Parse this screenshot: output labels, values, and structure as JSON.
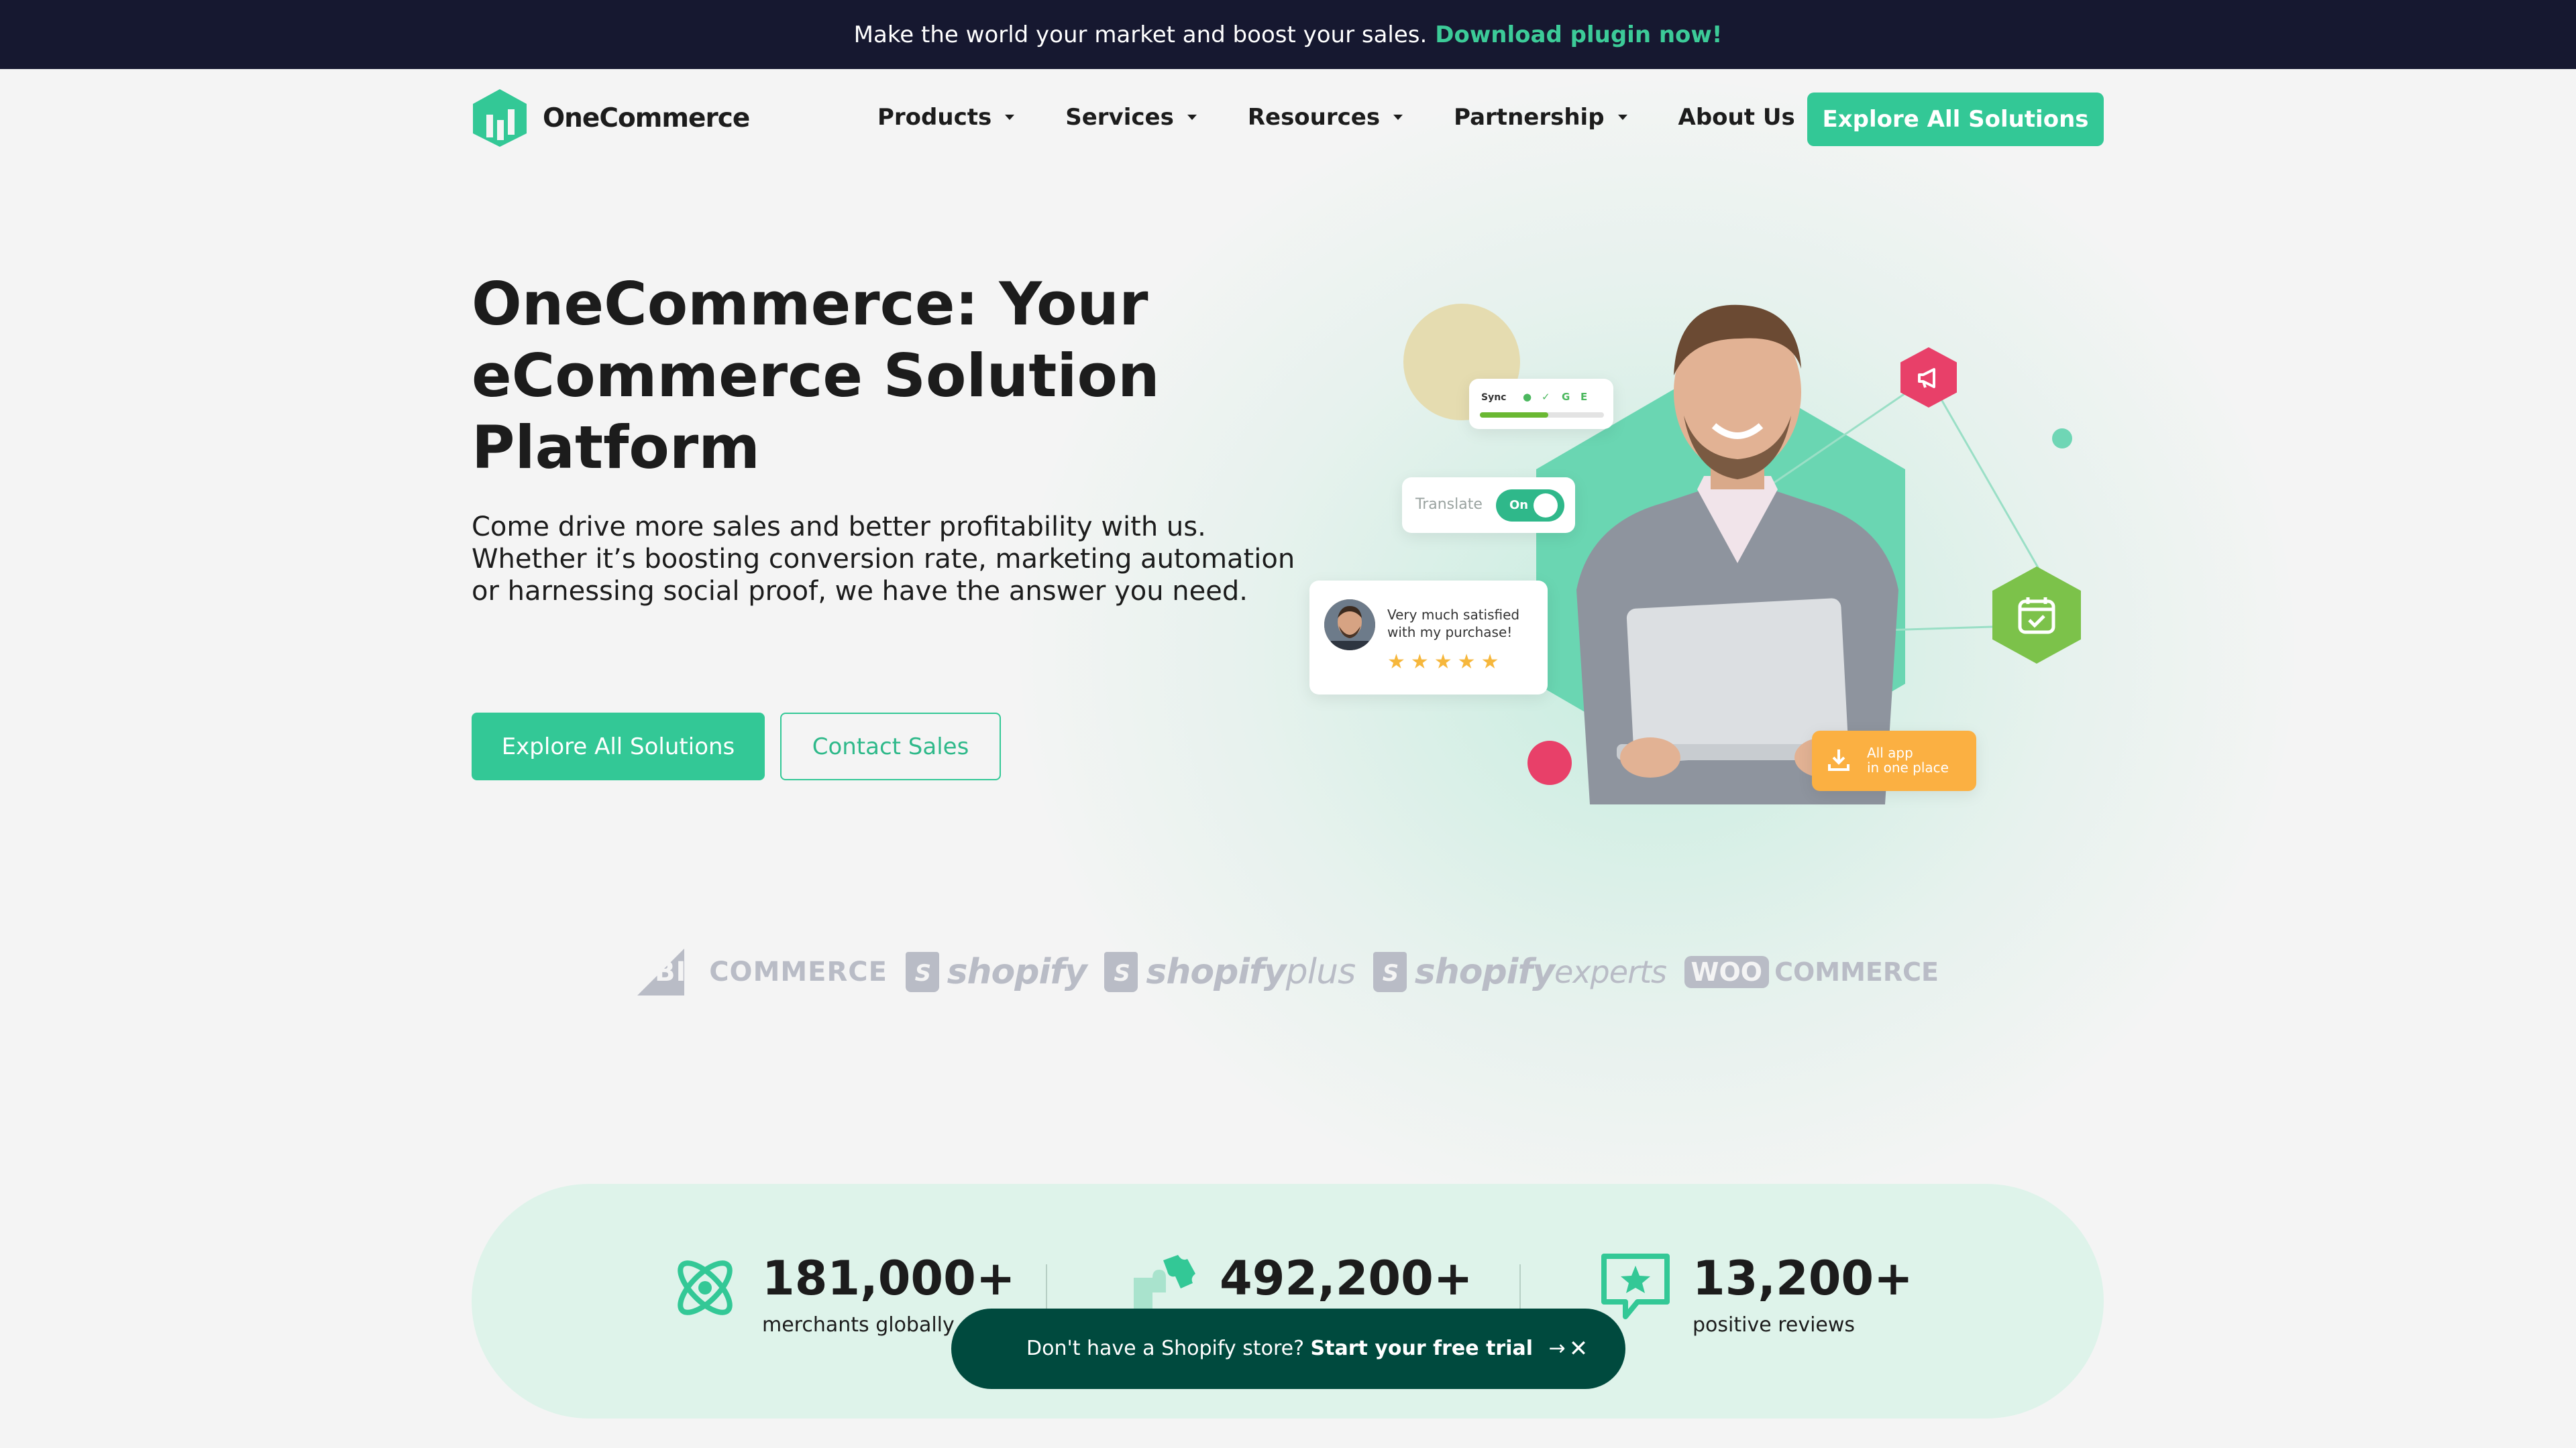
{
  "announcement": {
    "text": "Make the world your market and boost your sales.",
    "cta": "Download plugin now!"
  },
  "brand": {
    "name": "OneCommerce",
    "accent": "#33c896",
    "dark": "#161830"
  },
  "nav": {
    "items": [
      {
        "label": "Products",
        "has_dropdown": true
      },
      {
        "label": "Services",
        "has_dropdown": true
      },
      {
        "label": "Resources",
        "has_dropdown": true
      },
      {
        "label": "Partnership",
        "has_dropdown": true
      },
      {
        "label": "About Us",
        "has_dropdown": false
      }
    ],
    "cta": "Explore All Solutions"
  },
  "hero": {
    "title": "OneCommerce: Your eCommerce Solution Platform",
    "description": "Come drive more sales and better profitability with us. Whether it’s boosting conversion rate, marketing automation or harnessing social proof, we have the answer you need.",
    "primary_button": "Explore All Solutions",
    "secondary_button": "Contact Sales"
  },
  "illustration": {
    "sync_label": "Sync",
    "translate_label": "Translate",
    "toggle_label": "On",
    "review_text": "Very much satisfied with my purchase!",
    "review_stars": "★★★★★",
    "all_app_line1": "All app",
    "all_app_line2": "in one place"
  },
  "partners": {
    "bigcommerce_a": "BIG",
    "bigcommerce_b": "COMMERCE",
    "shopify": "shopify",
    "shopify_plus": "shopify",
    "plus": "plus",
    "shopify_experts": "shopify",
    "experts": "experts",
    "woo_a": "WOO",
    "woo_b": "COMMERCE"
  },
  "stats": [
    {
      "value": "181,000+",
      "label": "merchants globally",
      "icon": "atom-icon"
    },
    {
      "value": "492,200+",
      "label": "",
      "icon": "puzzle-icon"
    },
    {
      "value": "13,200+",
      "label": "positive reviews",
      "icon": "star-chat-icon"
    }
  ],
  "toast": {
    "text": "Don't have a Shopify store?",
    "cta": "Start your free trial",
    "arrow": "→",
    "close": "✕"
  }
}
